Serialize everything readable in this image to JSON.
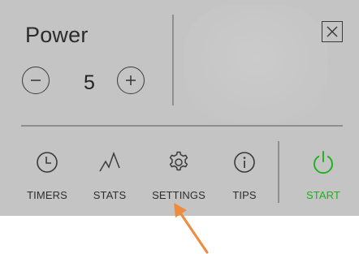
{
  "power": {
    "title": "Power",
    "value": "5",
    "decrease_symbol": "−",
    "increase_symbol": "+"
  },
  "dialog": {
    "close_icon": "close-icon"
  },
  "nav": {
    "items": [
      {
        "label": "TIMERS",
        "icon": "clock-icon"
      },
      {
        "label": "STATS",
        "icon": "zigzag-chart-icon"
      },
      {
        "label": "SETTINGS",
        "icon": "gear-icon"
      },
      {
        "label": "TIPS",
        "icon": "info-icon"
      }
    ],
    "start": {
      "label": "START",
      "icon": "power-icon",
      "color": "#1cb01c"
    }
  },
  "colors": {
    "panel_background": "#c4c4c4",
    "separator": "#8f8f8f",
    "annotation_arrow": "#f08a3c"
  },
  "annotation": {
    "icon": "pointer-arrow-icon",
    "target": "SETTINGS"
  }
}
